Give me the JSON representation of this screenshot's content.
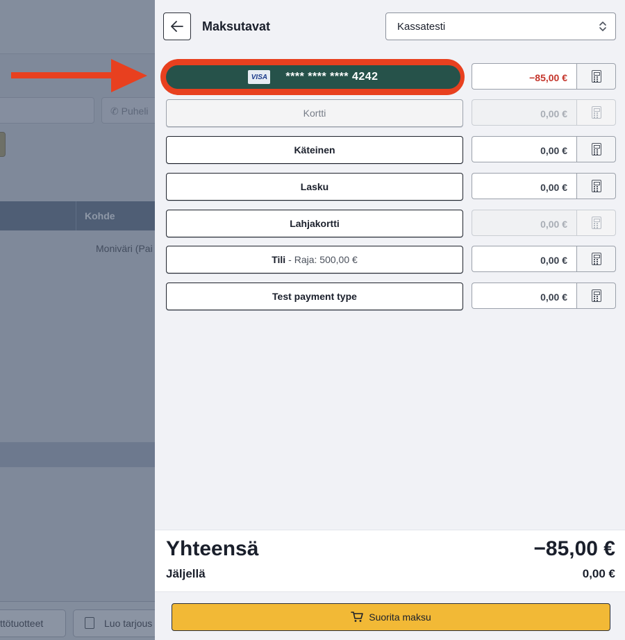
{
  "background": {
    "phone_placeholder": "Puheli",
    "table_column": "Kohde",
    "table_cell": "Moniväri (Pai",
    "bottom_button_1": "yttötuotteet",
    "bottom_button_2": "Luo tarjous"
  },
  "panel": {
    "title": "Maksutavat",
    "register_select": "Kassatesti"
  },
  "payment_rows": [
    {
      "label": "**** **** **** 4242",
      "card_brand": "VISA",
      "amount": "−85,00 €",
      "highlighted": true
    },
    {
      "label": "Kortti",
      "amount": "0,00 €",
      "disabled": true
    },
    {
      "label": "Käteinen",
      "amount": "0,00 €"
    },
    {
      "label": "Lasku",
      "amount": "0,00 €"
    },
    {
      "label": "Lahjakortti",
      "amount": "0,00 €",
      "amount_disabled": true
    },
    {
      "label": "Tili",
      "sub_label": "- Raja: 500,00 €",
      "amount": "0,00 €"
    },
    {
      "label": "Test payment type",
      "amount": "0,00 €"
    }
  ],
  "totals": {
    "total_label": "Yhteensä",
    "total_value": "−85,00 €",
    "remaining_label": "Jäljellä",
    "remaining_value": "0,00 €"
  },
  "submit": {
    "label": "Suorita maksu",
    "icon": "cart-icon"
  },
  "colors": {
    "card_button": "#26524a",
    "annotation": "#e8401f",
    "submit": "#f2b936",
    "negative_amount": "#c4352b"
  }
}
